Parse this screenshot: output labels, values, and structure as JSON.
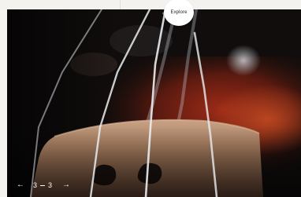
{
  "explore_button": {
    "label": "Explore",
    "prev_icon": "chevron-left-icon",
    "next_icon": "chevron-right-icon"
  },
  "hero": {
    "image": "violin-bridge-strings-photo"
  },
  "pager": {
    "prev_icon": "arrow-left-icon",
    "next_icon": "arrow-right-icon",
    "current": "3",
    "total": "3"
  }
}
